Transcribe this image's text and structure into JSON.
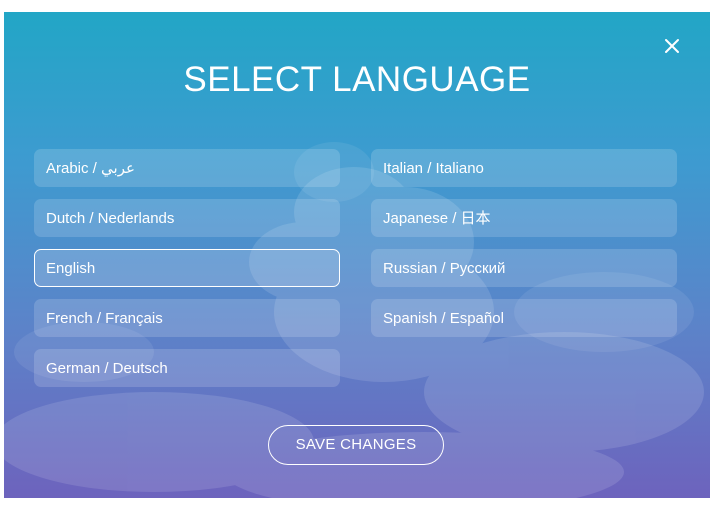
{
  "dialog": {
    "title": "SELECT LANGUAGE",
    "close_icon": "close-icon",
    "save_label": "SAVE CHANGES"
  },
  "languages": {
    "left": [
      {
        "label": "Arabic / عربي",
        "selected": false
      },
      {
        "label": "Dutch / Nederlands",
        "selected": false
      },
      {
        "label": "English",
        "selected": true
      },
      {
        "label": "French / Français",
        "selected": false
      },
      {
        "label": "German / Deutsch",
        "selected": false
      }
    ],
    "right": [
      {
        "label": "Italian / Italiano",
        "selected": false
      },
      {
        "label": "Japanese / 日本",
        "selected": false
      },
      {
        "label": "Russian / Русский",
        "selected": false
      },
      {
        "label": "Spanish / Español",
        "selected": false
      }
    ]
  },
  "colors": {
    "gradient_top": "#22a6c6",
    "gradient_bottom": "#6d63bd",
    "text": "#ffffff"
  }
}
